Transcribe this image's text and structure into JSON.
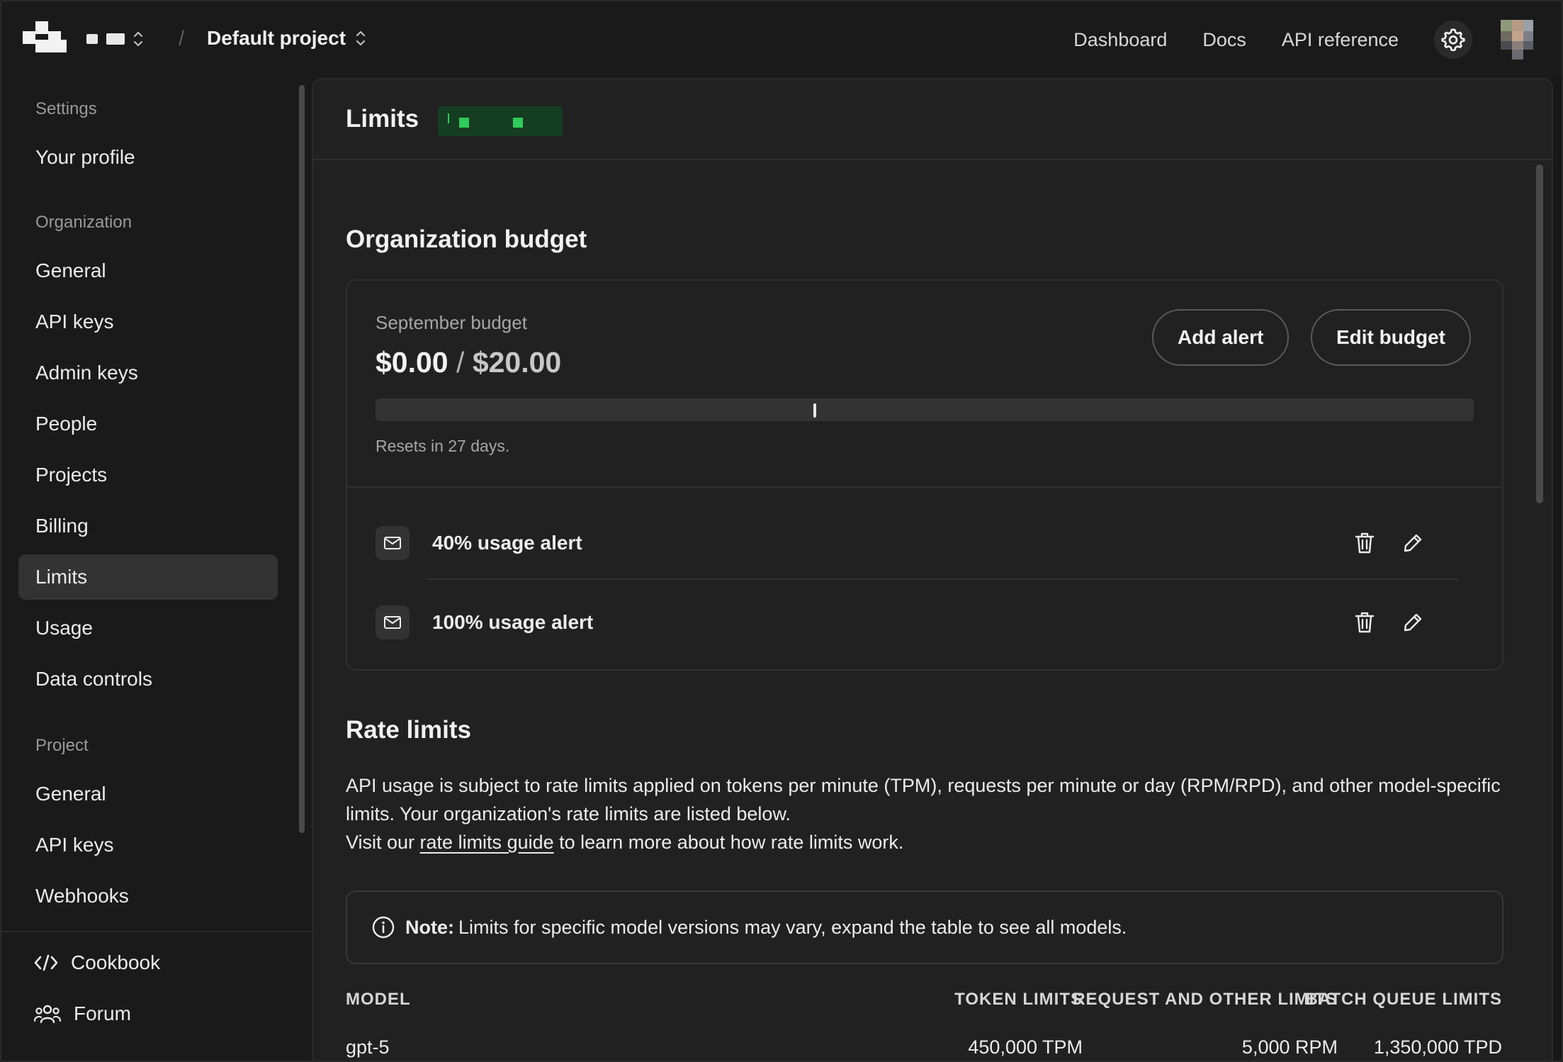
{
  "topbar": {
    "project_name": "Default project",
    "nav": [
      "Dashboard",
      "Docs",
      "API reference"
    ],
    "separator": "/"
  },
  "sidebar": {
    "sections": {
      "settings": "Settings",
      "organization": "Organization",
      "project": "Project"
    },
    "settings_items": [
      "Your profile"
    ],
    "organization_items": [
      "General",
      "API keys",
      "Admin keys",
      "People",
      "Projects",
      "Billing",
      "Limits",
      "Usage",
      "Data controls"
    ],
    "project_items": [
      "General",
      "API keys",
      "Webhooks"
    ],
    "active_item": "Limits",
    "footer_links": [
      {
        "label": "Cookbook",
        "icon": "code-icon"
      },
      {
        "label": "Forum",
        "icon": "people-icon"
      }
    ]
  },
  "page": {
    "title": "Limits"
  },
  "budget": {
    "heading": "Organization budget",
    "label": "September budget",
    "spent": "$0.00",
    "divider": "/",
    "limit": "$20.00",
    "progress_fraction": 0.0,
    "alert_marker_fraction": 0.4,
    "resets_text": "Resets in 27 days.",
    "add_alert_label": "Add alert",
    "edit_budget_label": "Edit budget",
    "alerts": [
      {
        "label": "40% usage alert"
      },
      {
        "label": "100% usage alert"
      }
    ]
  },
  "rate_limits": {
    "heading": "Rate limits",
    "description": "API usage is subject to rate limits applied on tokens per minute (TPM), requests per minute or day (RPM/RPD), and other model-specific limits. Your organization's rate limits are listed below.",
    "visit_prefix": "Visit our ",
    "guide_link": "rate limits guide",
    "visit_suffix": " to learn more about how rate limits work.",
    "note_label": "Note:",
    "note_text": "Limits for specific model versions may vary, expand the table to see all models.",
    "columns": [
      "MODEL",
      "TOKEN LIMITS",
      "REQUEST AND OTHER LIMITS",
      "BATCH QUEUE LIMITS"
    ],
    "rows": [
      {
        "model": "gpt-5",
        "token": "450,000 TPM",
        "request": "5,000 RPM",
        "batch": "1,350,000 TPD"
      }
    ]
  },
  "colors": {
    "background": "#181818",
    "panel": "#212121",
    "active_item": "#333333",
    "badge": "#143d22"
  }
}
